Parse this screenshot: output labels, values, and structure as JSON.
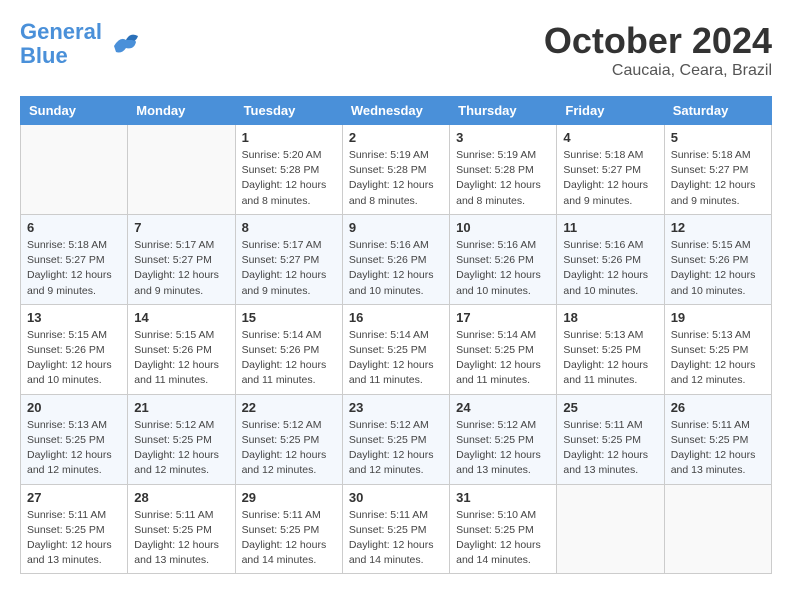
{
  "header": {
    "logo_line1": "General",
    "logo_line2": "Blue",
    "month": "October 2024",
    "location": "Caucaia, Ceara, Brazil"
  },
  "weekdays": [
    "Sunday",
    "Monday",
    "Tuesday",
    "Wednesday",
    "Thursday",
    "Friday",
    "Saturday"
  ],
  "weeks": [
    [
      {
        "day": "",
        "info": ""
      },
      {
        "day": "",
        "info": ""
      },
      {
        "day": "1",
        "info": "Sunrise: 5:20 AM\nSunset: 5:28 PM\nDaylight: 12 hours\nand 8 minutes."
      },
      {
        "day": "2",
        "info": "Sunrise: 5:19 AM\nSunset: 5:28 PM\nDaylight: 12 hours\nand 8 minutes."
      },
      {
        "day": "3",
        "info": "Sunrise: 5:19 AM\nSunset: 5:28 PM\nDaylight: 12 hours\nand 8 minutes."
      },
      {
        "day": "4",
        "info": "Sunrise: 5:18 AM\nSunset: 5:27 PM\nDaylight: 12 hours\nand 9 minutes."
      },
      {
        "day": "5",
        "info": "Sunrise: 5:18 AM\nSunset: 5:27 PM\nDaylight: 12 hours\nand 9 minutes."
      }
    ],
    [
      {
        "day": "6",
        "info": "Sunrise: 5:18 AM\nSunset: 5:27 PM\nDaylight: 12 hours\nand 9 minutes."
      },
      {
        "day": "7",
        "info": "Sunrise: 5:17 AM\nSunset: 5:27 PM\nDaylight: 12 hours\nand 9 minutes."
      },
      {
        "day": "8",
        "info": "Sunrise: 5:17 AM\nSunset: 5:27 PM\nDaylight: 12 hours\nand 9 minutes."
      },
      {
        "day": "9",
        "info": "Sunrise: 5:16 AM\nSunset: 5:26 PM\nDaylight: 12 hours\nand 10 minutes."
      },
      {
        "day": "10",
        "info": "Sunrise: 5:16 AM\nSunset: 5:26 PM\nDaylight: 12 hours\nand 10 minutes."
      },
      {
        "day": "11",
        "info": "Sunrise: 5:16 AM\nSunset: 5:26 PM\nDaylight: 12 hours\nand 10 minutes."
      },
      {
        "day": "12",
        "info": "Sunrise: 5:15 AM\nSunset: 5:26 PM\nDaylight: 12 hours\nand 10 minutes."
      }
    ],
    [
      {
        "day": "13",
        "info": "Sunrise: 5:15 AM\nSunset: 5:26 PM\nDaylight: 12 hours\nand 10 minutes."
      },
      {
        "day": "14",
        "info": "Sunrise: 5:15 AM\nSunset: 5:26 PM\nDaylight: 12 hours\nand 11 minutes."
      },
      {
        "day": "15",
        "info": "Sunrise: 5:14 AM\nSunset: 5:26 PM\nDaylight: 12 hours\nand 11 minutes."
      },
      {
        "day": "16",
        "info": "Sunrise: 5:14 AM\nSunset: 5:25 PM\nDaylight: 12 hours\nand 11 minutes."
      },
      {
        "day": "17",
        "info": "Sunrise: 5:14 AM\nSunset: 5:25 PM\nDaylight: 12 hours\nand 11 minutes."
      },
      {
        "day": "18",
        "info": "Sunrise: 5:13 AM\nSunset: 5:25 PM\nDaylight: 12 hours\nand 11 minutes."
      },
      {
        "day": "19",
        "info": "Sunrise: 5:13 AM\nSunset: 5:25 PM\nDaylight: 12 hours\nand 12 minutes."
      }
    ],
    [
      {
        "day": "20",
        "info": "Sunrise: 5:13 AM\nSunset: 5:25 PM\nDaylight: 12 hours\nand 12 minutes."
      },
      {
        "day": "21",
        "info": "Sunrise: 5:12 AM\nSunset: 5:25 PM\nDaylight: 12 hours\nand 12 minutes."
      },
      {
        "day": "22",
        "info": "Sunrise: 5:12 AM\nSunset: 5:25 PM\nDaylight: 12 hours\nand 12 minutes."
      },
      {
        "day": "23",
        "info": "Sunrise: 5:12 AM\nSunset: 5:25 PM\nDaylight: 12 hours\nand 12 minutes."
      },
      {
        "day": "24",
        "info": "Sunrise: 5:12 AM\nSunset: 5:25 PM\nDaylight: 12 hours\nand 13 minutes."
      },
      {
        "day": "25",
        "info": "Sunrise: 5:11 AM\nSunset: 5:25 PM\nDaylight: 12 hours\nand 13 minutes."
      },
      {
        "day": "26",
        "info": "Sunrise: 5:11 AM\nSunset: 5:25 PM\nDaylight: 12 hours\nand 13 minutes."
      }
    ],
    [
      {
        "day": "27",
        "info": "Sunrise: 5:11 AM\nSunset: 5:25 PM\nDaylight: 12 hours\nand 13 minutes."
      },
      {
        "day": "28",
        "info": "Sunrise: 5:11 AM\nSunset: 5:25 PM\nDaylight: 12 hours\nand 13 minutes."
      },
      {
        "day": "29",
        "info": "Sunrise: 5:11 AM\nSunset: 5:25 PM\nDaylight: 12 hours\nand 14 minutes."
      },
      {
        "day": "30",
        "info": "Sunrise: 5:11 AM\nSunset: 5:25 PM\nDaylight: 12 hours\nand 14 minutes."
      },
      {
        "day": "31",
        "info": "Sunrise: 5:10 AM\nSunset: 5:25 PM\nDaylight: 12 hours\nand 14 minutes."
      },
      {
        "day": "",
        "info": ""
      },
      {
        "day": "",
        "info": ""
      }
    ]
  ]
}
